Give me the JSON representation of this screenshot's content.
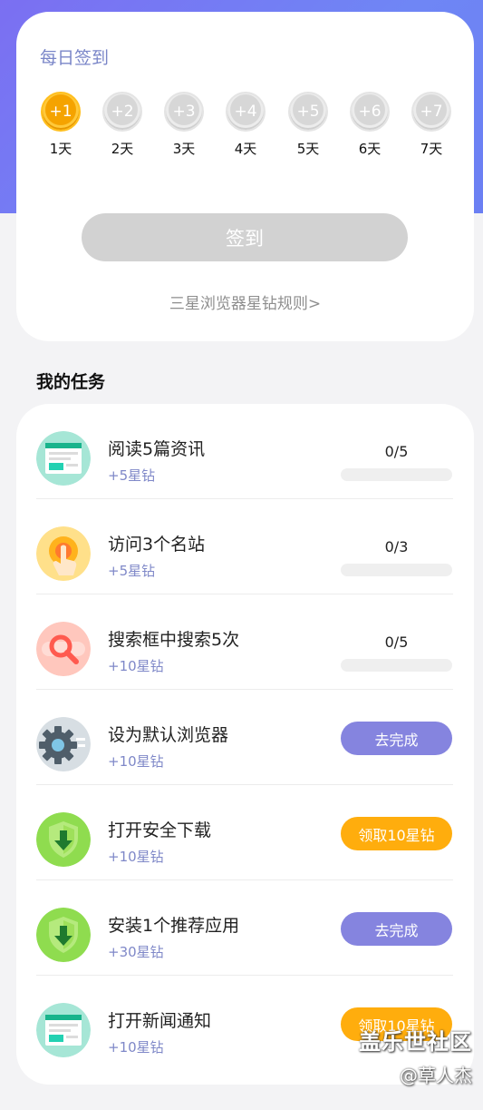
{
  "checkin": {
    "title": "每日签到",
    "days": [
      {
        "reward": "+1",
        "label": "1天",
        "state": "current"
      },
      {
        "reward": "+2",
        "label": "2天",
        "state": "pending"
      },
      {
        "reward": "+3",
        "label": "3天",
        "state": "pending"
      },
      {
        "reward": "+4",
        "label": "4天",
        "state": "pending"
      },
      {
        "reward": "+5",
        "label": "5天",
        "state": "pending"
      },
      {
        "reward": "+6",
        "label": "6天",
        "state": "pending"
      },
      {
        "reward": "+7",
        "label": "7天",
        "state": "pending"
      }
    ],
    "button_label": "签到",
    "rules_link": "三星浏览器星钻规则>"
  },
  "tasks_section": {
    "title": "我的任务",
    "tasks": [
      {
        "title": "阅读5篇资讯",
        "reward": "+5星钻",
        "progress_text": "0/5",
        "progress_fraction": 0,
        "icon": "news-icon"
      },
      {
        "title": "访问3个名站",
        "reward": "+5星钻",
        "progress_text": "0/3",
        "progress_fraction": 0,
        "icon": "tap-finger-icon"
      },
      {
        "title": "搜索框中搜索5次",
        "reward": "+10星钻",
        "progress_text": "0/5",
        "progress_fraction": 0,
        "icon": "search-icon"
      },
      {
        "title": "设为默认浏览器",
        "reward": "+10星钻",
        "action": "去完成",
        "icon": "gear-icon"
      },
      {
        "title": "打开安全下载",
        "reward": "+10星钻",
        "action": "领取10星钻",
        "icon": "shield-download-icon"
      },
      {
        "title": "安装1个推荐应用",
        "reward": "+30星钻",
        "action": "去完成",
        "icon": "shield-download-icon"
      },
      {
        "title": "打开新闻通知",
        "reward": "+10星钻",
        "action": "领取10星钻",
        "icon": "news-icon"
      }
    ]
  },
  "watermark": {
    "line1": "盖乐世社区",
    "line2": "@草人杰"
  },
  "colors": {
    "accent_purple": "#8584df",
    "accent_orange": "#ffad0d",
    "header_gradient": "#7b6ff2"
  }
}
